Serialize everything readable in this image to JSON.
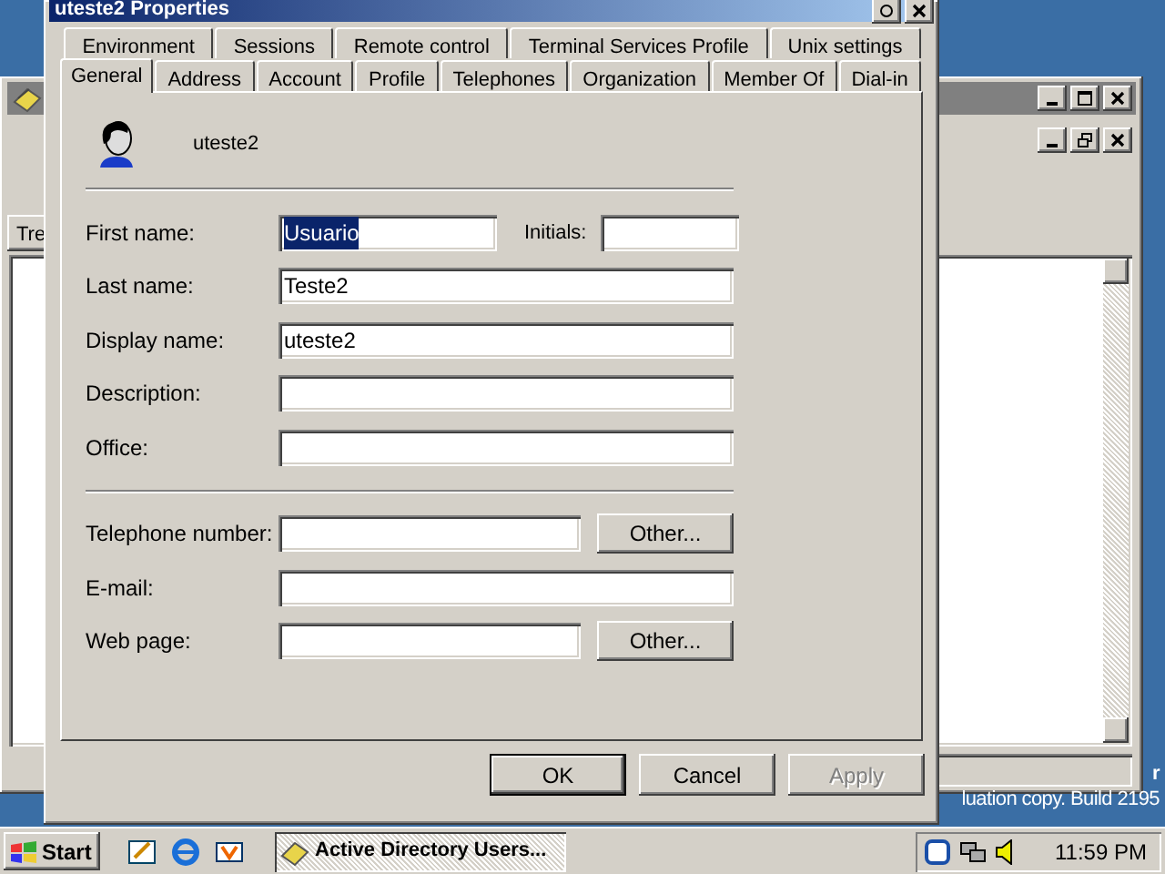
{
  "background_window": {
    "tab_label": "Tre"
  },
  "dialog": {
    "title": "uteste2 Properties",
    "tabs_row_1": [
      {
        "label": "Environment",
        "selected": false
      },
      {
        "label": "Sessions",
        "selected": false
      },
      {
        "label": "Remote control",
        "selected": false
      },
      {
        "label": "Terminal Services Profile",
        "selected": false
      },
      {
        "label": "Unix settings",
        "selected": false
      }
    ],
    "tabs_row_2": [
      {
        "label": "General",
        "selected": true
      },
      {
        "label": "Address",
        "selected": false
      },
      {
        "label": "Account",
        "selected": false
      },
      {
        "label": "Profile",
        "selected": false
      },
      {
        "label": "Telephones",
        "selected": false
      },
      {
        "label": "Organization",
        "selected": false
      },
      {
        "label": "Member Of",
        "selected": false
      },
      {
        "label": "Dial-in",
        "selected": false
      }
    ],
    "user_name": "uteste2",
    "name_fields": [
      {
        "kind": "pair",
        "label": "First name:",
        "value": "Usuario",
        "value_selected": true,
        "second_label": "Initials:"
      },
      {
        "kind": "full",
        "label": "Last name:",
        "value": "Teste2",
        "value_selected": false
      },
      {
        "kind": "full",
        "label": "Display name:",
        "value": "uteste2",
        "value_selected": false
      },
      {
        "kind": "full",
        "label": "Description:"
      },
      {
        "kind": "full",
        "label": "Office:"
      }
    ],
    "contact_fields": [
      {
        "kind": "button",
        "label": "Telephone number:",
        "button": "Other..."
      },
      {
        "kind": "full",
        "label": "E-mail:"
      },
      {
        "kind": "button",
        "label": "Web page:",
        "button": "Other..."
      }
    ],
    "buttons": [
      {
        "label": "OK",
        "default": true,
        "disabled": false
      },
      {
        "label": "Cancel",
        "default": false,
        "disabled": false
      },
      {
        "label": "Apply",
        "default": false,
        "disabled": true
      }
    ]
  },
  "desktop_text": [
    "r",
    "luation copy. Build 2195"
  ],
  "taskbar": {
    "start": "Start",
    "task": "Active Directory Users...",
    "clock": "11:59 PM"
  }
}
